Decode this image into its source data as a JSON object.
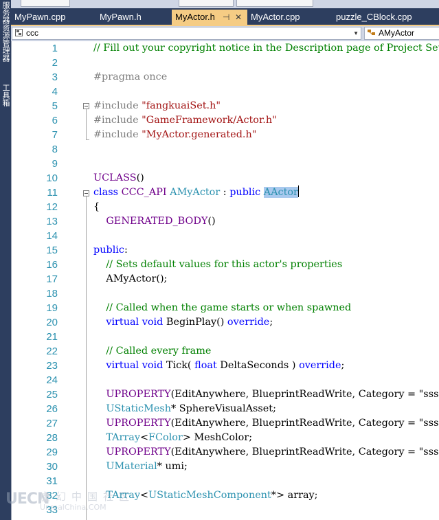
{
  "side_panel": {
    "label_1": "服务器资源管理器",
    "label_2": "工具箱"
  },
  "tabs": [
    {
      "label": "MyPawn.cpp",
      "active": false
    },
    {
      "label": "MyPawn.h",
      "active": false
    },
    {
      "label": "MyActor.h",
      "active": true,
      "pin": "⊣",
      "close": "✕"
    },
    {
      "label": "MyActor.cpp",
      "active": false
    },
    {
      "label": "puzzle_CBlock.cpp",
      "active": false
    }
  ],
  "navigation": {
    "scope_value": "ccc",
    "member_value": "AMyActor"
  },
  "colors": {
    "tab_active": "#f5cc84",
    "chrome_dark": "#2d3e5f",
    "comment": "#008000",
    "keyword": "#0000ff",
    "type": "#2b91af",
    "macro": "#6f008a",
    "string": "#a31515",
    "highlight": "#a8c9ee"
  },
  "editor": {
    "lines": [
      {
        "n": "1",
        "tokens": [
          {
            "t": "// Fill out your copyright notice in the Description page of Project Settings.",
            "c": "cm"
          }
        ]
      },
      {
        "n": "2",
        "tokens": []
      },
      {
        "n": "3",
        "tokens": [
          {
            "t": "#pragma once",
            "c": "pp"
          }
        ]
      },
      {
        "n": "4",
        "tokens": []
      },
      {
        "n": "5",
        "tokens": [
          {
            "t": "#include ",
            "c": "pp"
          },
          {
            "t": "\"fangkuaiSet.h\"",
            "c": "str"
          }
        ]
      },
      {
        "n": "6",
        "tokens": [
          {
            "t": "#include ",
            "c": "pp"
          },
          {
            "t": "\"GameFramework/Actor.h\"",
            "c": "str"
          }
        ]
      },
      {
        "n": "7",
        "tokens": [
          {
            "t": "#include ",
            "c": "pp"
          },
          {
            "t": "\"MyActor.generated.h\"",
            "c": "str"
          }
        ]
      },
      {
        "n": "8",
        "tokens": []
      },
      {
        "n": "9",
        "tokens": []
      },
      {
        "n": "10",
        "tokens": [
          {
            "t": "UCLASS",
            "c": "mac"
          },
          {
            "t": "()",
            "c": ""
          }
        ]
      },
      {
        "n": "11",
        "tokens": [
          {
            "t": "class ",
            "c": "kw"
          },
          {
            "t": "CCC_API",
            "c": "mac"
          },
          {
            "t": " ",
            "c": ""
          },
          {
            "t": "AMyActor",
            "c": "ty"
          },
          {
            "t": " : ",
            "c": ""
          },
          {
            "t": "public",
            "c": "kw"
          },
          {
            "t": " ",
            "c": ""
          },
          {
            "t": "AActor",
            "c": "ty hl"
          },
          {
            "t": "",
            "c": "caret"
          }
        ]
      },
      {
        "n": "12",
        "tokens": [
          {
            "t": "{",
            "c": ""
          }
        ]
      },
      {
        "n": "13",
        "tokens": [
          {
            "t": "    ",
            "c": ""
          },
          {
            "t": "GENERATED_BODY",
            "c": "mac"
          },
          {
            "t": "()",
            "c": ""
          }
        ]
      },
      {
        "n": "14",
        "tokens": []
      },
      {
        "n": "15",
        "tokens": [
          {
            "t": "public",
            "c": "kw"
          },
          {
            "t": ":",
            "c": ""
          }
        ]
      },
      {
        "n": "16",
        "tokens": [
          {
            "t": "    ",
            "c": ""
          },
          {
            "t": "// Sets default values for this actor's properties",
            "c": "cm"
          }
        ]
      },
      {
        "n": "17",
        "tokens": [
          {
            "t": "    AMyActor();",
            "c": ""
          }
        ]
      },
      {
        "n": "18",
        "tokens": []
      },
      {
        "n": "19",
        "tokens": [
          {
            "t": "    ",
            "c": ""
          },
          {
            "t": "// Called when the game starts or when spawned",
            "c": "cm"
          }
        ]
      },
      {
        "n": "20",
        "tokens": [
          {
            "t": "    ",
            "c": ""
          },
          {
            "t": "virtual",
            "c": "kw"
          },
          {
            "t": " ",
            "c": ""
          },
          {
            "t": "void",
            "c": "kw"
          },
          {
            "t": " BeginPlay() ",
            "c": ""
          },
          {
            "t": "override",
            "c": "kw"
          },
          {
            "t": ";",
            "c": ""
          }
        ]
      },
      {
        "n": "21",
        "tokens": []
      },
      {
        "n": "22",
        "tokens": [
          {
            "t": "    ",
            "c": ""
          },
          {
            "t": "// Called every frame",
            "c": "cm"
          }
        ]
      },
      {
        "n": "23",
        "tokens": [
          {
            "t": "    ",
            "c": ""
          },
          {
            "t": "virtual",
            "c": "kw"
          },
          {
            "t": " ",
            "c": ""
          },
          {
            "t": "void",
            "c": "kw"
          },
          {
            "t": " Tick( ",
            "c": ""
          },
          {
            "t": "float",
            "c": "kw"
          },
          {
            "t": " DeltaSeconds ) ",
            "c": ""
          },
          {
            "t": "override",
            "c": "kw"
          },
          {
            "t": ";",
            "c": ""
          }
        ]
      },
      {
        "n": "24",
        "tokens": []
      },
      {
        "n": "25",
        "tokens": [
          {
            "t": "    ",
            "c": ""
          },
          {
            "t": "UPROPERTY",
            "c": "mac"
          },
          {
            "t": "(EditAnywhere, BlueprintReadWrite, Category = \"sss\")",
            "c": ""
          }
        ]
      },
      {
        "n": "26",
        "tokens": [
          {
            "t": "    ",
            "c": ""
          },
          {
            "t": "UStaticMesh",
            "c": "ty"
          },
          {
            "t": "* SphereVisualAsset;",
            "c": ""
          }
        ]
      },
      {
        "n": "27",
        "tokens": [
          {
            "t": "    ",
            "c": ""
          },
          {
            "t": "UPROPERTY",
            "c": "mac"
          },
          {
            "t": "(EditAnywhere, BlueprintReadWrite, Category = \"sss\")",
            "c": ""
          }
        ]
      },
      {
        "n": "28",
        "tokens": [
          {
            "t": "    ",
            "c": ""
          },
          {
            "t": "TArray",
            "c": "ty"
          },
          {
            "t": "<",
            "c": ""
          },
          {
            "t": "FColor",
            "c": "ty"
          },
          {
            "t": "> MeshColor;",
            "c": ""
          }
        ]
      },
      {
        "n": "29",
        "tokens": [
          {
            "t": "    ",
            "c": ""
          },
          {
            "t": "UPROPERTY",
            "c": "mac"
          },
          {
            "t": "(EditAnywhere, BlueprintReadWrite, Category = \"sss\")",
            "c": ""
          }
        ]
      },
      {
        "n": "30",
        "tokens": [
          {
            "t": "    ",
            "c": ""
          },
          {
            "t": "UMaterial",
            "c": "ty"
          },
          {
            "t": "* umi;",
            "c": ""
          }
        ]
      },
      {
        "n": "31",
        "tokens": []
      },
      {
        "n": "32",
        "tokens": [
          {
            "t": "    ",
            "c": ""
          },
          {
            "t": "TArray",
            "c": "ty"
          },
          {
            "t": "<",
            "c": ""
          },
          {
            "t": "UStaticMeshComponent",
            "c": "ty"
          },
          {
            "t": "*> array;",
            "c": ""
          }
        ]
      },
      {
        "n": "33",
        "tokens": []
      }
    ]
  },
  "watermark": {
    "mark": "UECN",
    "cn": "虚幻中国社区",
    "url": "UnrealChina.COM"
  }
}
